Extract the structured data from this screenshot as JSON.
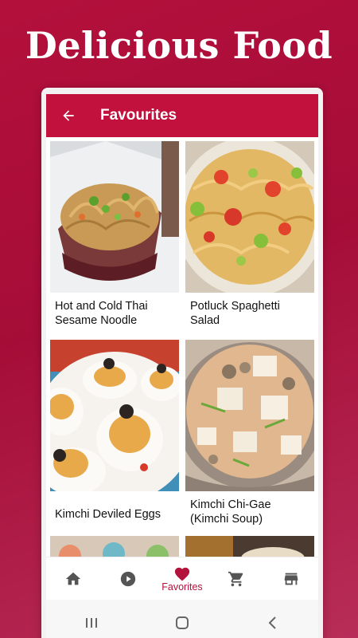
{
  "promo": {
    "headline": "Delicious Food"
  },
  "appbar": {
    "title": "Favourites",
    "back_icon": "arrow-back-icon"
  },
  "favourites": [
    {
      "name": "Hot  and Cold Thai Sesame Noodle",
      "image": "noodle-bowl-photo"
    },
    {
      "name": "Potluck Spaghetti Salad",
      "image": "spaghetti-salad-photo"
    },
    {
      "name": "Kimchi Deviled Eggs",
      "image": "deviled-eggs-photo"
    },
    {
      "name": "Kimchi Chi-Gae (Kimchi Soup)",
      "image": "kimchi-soup-photo"
    }
  ],
  "bottom_nav": {
    "items": [
      {
        "icon": "home-icon",
        "label": ""
      },
      {
        "icon": "play-circle-icon",
        "label": ""
      },
      {
        "icon": "heart-icon",
        "label": "Favorites",
        "active": true
      },
      {
        "icon": "cart-icon",
        "label": ""
      },
      {
        "icon": "store-icon",
        "label": ""
      }
    ]
  },
  "colors": {
    "accent": "#c3113e",
    "background": "#a50d37"
  }
}
